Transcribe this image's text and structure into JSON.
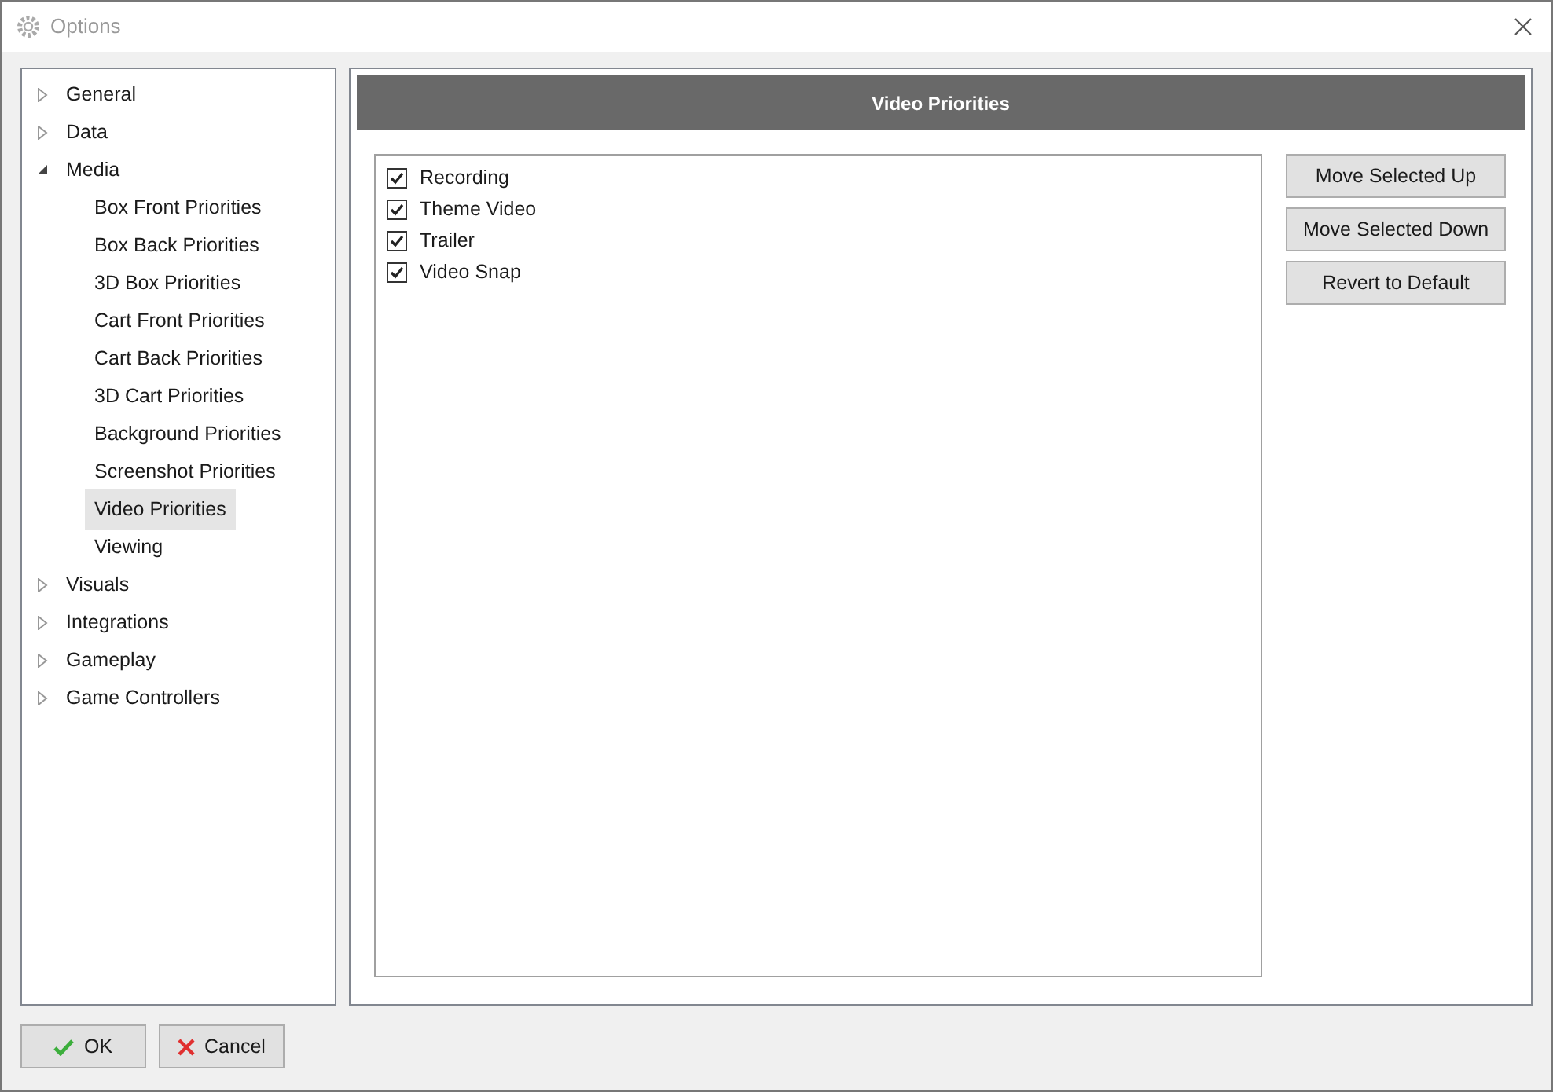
{
  "window": {
    "title": "Options"
  },
  "tree": [
    {
      "label": "General",
      "expanded": false,
      "selected": false
    },
    {
      "label": "Data",
      "expanded": false,
      "selected": false
    },
    {
      "label": "Media",
      "expanded": true,
      "selected": false,
      "children": [
        {
          "label": "Box Front Priorities",
          "selected": false
        },
        {
          "label": "Box Back Priorities",
          "selected": false
        },
        {
          "label": "3D Box Priorities",
          "selected": false
        },
        {
          "label": "Cart Front Priorities",
          "selected": false
        },
        {
          "label": "Cart Back Priorities",
          "selected": false
        },
        {
          "label": "3D Cart Priorities",
          "selected": false
        },
        {
          "label": "Background Priorities",
          "selected": false
        },
        {
          "label": "Screenshot Priorities",
          "selected": false
        },
        {
          "label": "Video Priorities",
          "selected": true
        },
        {
          "label": "Viewing",
          "selected": false
        }
      ]
    },
    {
      "label": "Visuals",
      "expanded": false,
      "selected": false
    },
    {
      "label": "Integrations",
      "expanded": false,
      "selected": false
    },
    {
      "label": "Gameplay",
      "expanded": false,
      "selected": false
    },
    {
      "label": "Game Controllers",
      "expanded": false,
      "selected": false
    }
  ],
  "panel": {
    "title": "Video Priorities",
    "items": [
      {
        "label": "Recording",
        "checked": true
      },
      {
        "label": "Theme Video",
        "checked": true
      },
      {
        "label": "Trailer",
        "checked": true
      },
      {
        "label": "Video Snap",
        "checked": true
      }
    ],
    "buttons": [
      "Move Selected Up",
      "Move Selected Down",
      "Revert to Default"
    ]
  },
  "footer": [
    {
      "label": "OK",
      "kind": "ok"
    },
    {
      "label": "Cancel",
      "kind": "cancel"
    }
  ]
}
